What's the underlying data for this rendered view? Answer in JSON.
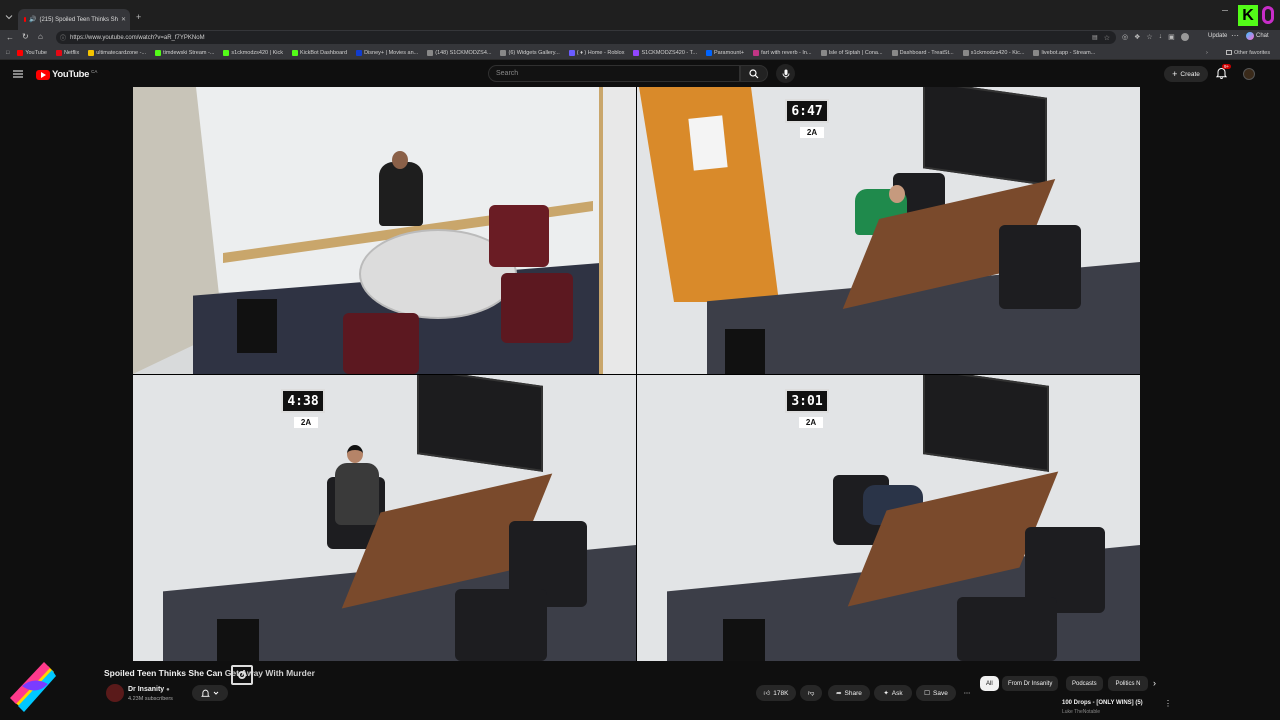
{
  "browser": {
    "tab_title": "(215) Spoiled Teen Thinks Sh",
    "url": "https://www.youtube.com/watch?v=aR_f7YPKNoM",
    "update_label": "Update",
    "chat_label": "Chat",
    "other_favorites": "Other favorites",
    "bookmarks": [
      {
        "label": "YouTube",
        "color": "#ff0000"
      },
      {
        "label": "Netflix",
        "color": "#e50914"
      },
      {
        "label": "ultimatecardzone -...",
        "color": "#f5c400"
      },
      {
        "label": "timdewski Stream -...",
        "color": "#53fc18"
      },
      {
        "label": "s1ckmodzs420 | Kick",
        "color": "#53fc18"
      },
      {
        "label": "KickBot Dashboard",
        "color": "#53fc18"
      },
      {
        "label": "Disney+ | Movies an...",
        "color": "#113ccf"
      },
      {
        "label": "(148) S1CKMODZS4...",
        "color": "#888888"
      },
      {
        "label": "(6) Widgets Gallery...",
        "color": "#888888"
      },
      {
        "label": "( ♦ ) Home - Roblox",
        "color": "#6a5cff"
      },
      {
        "label": "S1CKMODZS420 - T...",
        "color": "#9146ff"
      },
      {
        "label": "Paramount+",
        "color": "#0064ff"
      },
      {
        "label": "fart with reverb - In...",
        "color": "#c13584"
      },
      {
        "label": "Isle of Siptah | Cona...",
        "color": "#888888"
      },
      {
        "label": "Dashboard - TreatSt...",
        "color": "#888888"
      },
      {
        "label": "s1ckmodzs420 - Kic...",
        "color": "#888888"
      },
      {
        "label": "livebot.app - Stream...",
        "color": "#888888"
      }
    ]
  },
  "youtube": {
    "logo_text": "YouTube",
    "logo_region": "CA",
    "search_placeholder": "Search",
    "create_label": "Create",
    "notification_count": "9+"
  },
  "video": {
    "cams": [
      {
        "clock": "",
        "room": ""
      },
      {
        "clock": "6:47",
        "room": "2A"
      },
      {
        "clock": "4:38",
        "room": "2A"
      },
      {
        "clock": "3:01",
        "room": "2A"
      }
    ]
  },
  "info": {
    "title": "Spoiled Teen Thinks She Can",
    "title_overlay": "Get Away With Murder",
    "channel_name": "Dr Insanity",
    "subscribers": "4.23M subscribers",
    "likes": "178K",
    "share_label": "Share",
    "ask_label": "Ask",
    "save_label": "Save"
  },
  "chips": {
    "all": "All",
    "from_channel": "From Dr Insanity",
    "podcasts": "Podcasts",
    "politics": "Politics N"
  },
  "sidebar_preview": {
    "title": "100 Drops - [ONLY WINS] (5)",
    "subtitle": "Luke TheNotable"
  },
  "colors": {
    "accent": "#ff0000",
    "kick_green": "#53fc18",
    "background": "#0f0f0f"
  }
}
